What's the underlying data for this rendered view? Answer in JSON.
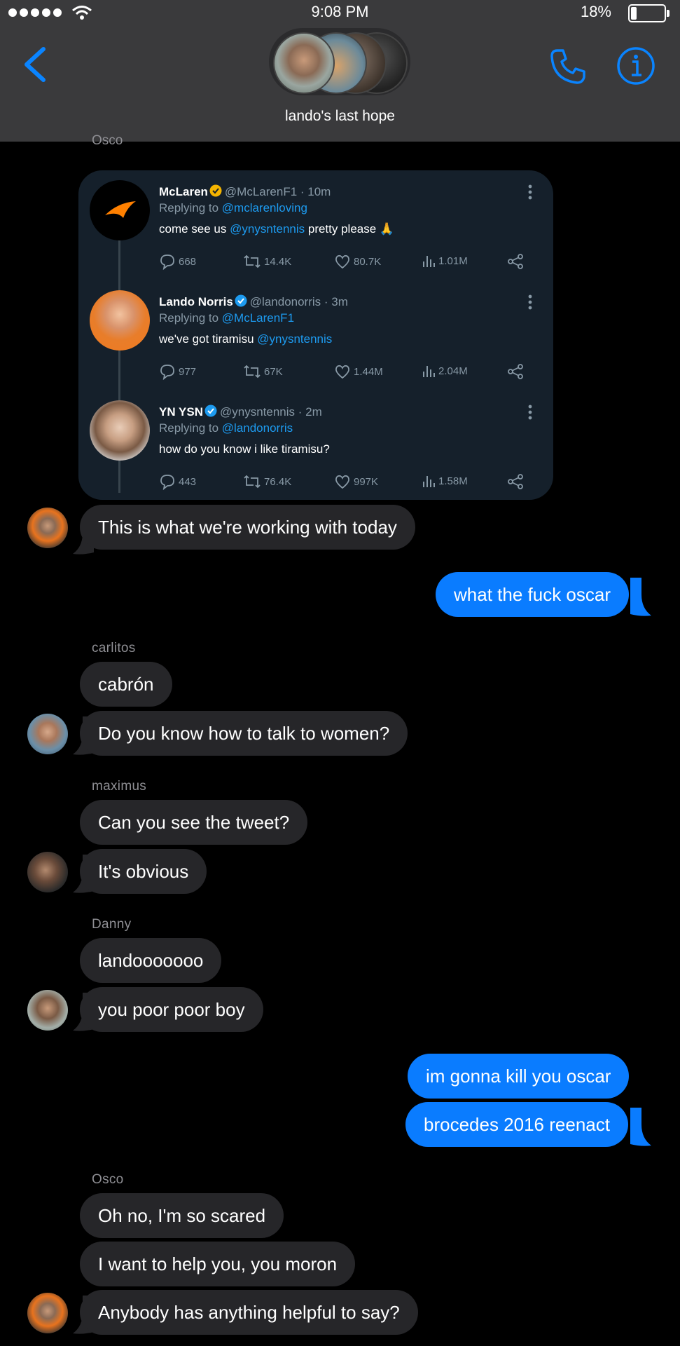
{
  "status_bar": {
    "time": "9:08 PM",
    "battery": "18%",
    "battery_level": 0.18
  },
  "header": {
    "title": "lando's last hope"
  },
  "top_sender": "Osco",
  "tweets": [
    {
      "name": "McLaren",
      "handle": "@McLarenF1 · 10m",
      "reply_prefix": "Replying to ",
      "reply_to": "@mclarenloving",
      "text_pre": "come see us ",
      "text_mention": "@ynysntennis",
      "text_post": " pretty please 🙏",
      "replies": "668",
      "retweets": "14.4K",
      "likes": "80.7K",
      "views": "1.01M",
      "badge_color": "#f4b400"
    },
    {
      "name": "Lando Norris",
      "handle": "@landonorris · 3m",
      "reply_prefix": "Replying to ",
      "reply_to": "@McLarenF1",
      "text_pre": "we've got tiramisu ",
      "text_mention": "@ynysntennis",
      "text_post": "",
      "replies": "977",
      "retweets": "67K",
      "likes": "1.44M",
      "views": "2.04M",
      "badge_color": "#1d9bf0"
    },
    {
      "name": "YN YSN",
      "handle": "@ynysntennis · 2m",
      "reply_prefix": "Replying to ",
      "reply_to": "@landonorris",
      "text_pre": "how do you know i like tiramisu?",
      "text_mention": "",
      "text_post": "",
      "replies": "443",
      "retweets": "76.4K",
      "likes": "997K",
      "views": "1.58M",
      "badge_color": "#1d9bf0"
    }
  ],
  "messages": {
    "m1": "This is what we're working with today",
    "m2": "what the fuck oscar",
    "carlitos": "carlitos",
    "m3": "cabrón",
    "m4": "Do you know how to talk to women?",
    "maximus": "maximus",
    "m5": "Can you see the tweet?",
    "m6": "It's obvious",
    "danny": "Danny",
    "m7": "landooooooo",
    "m8": "you poor poor boy",
    "m9": "im gonna kill you oscar",
    "m10": "brocedes 2016 reenact",
    "osco": "Osco",
    "m11": "Oh no, I'm so scared",
    "m12": "I want to help you, you moron",
    "m13": "Anybody has anything helpful to say?"
  },
  "colors": {
    "sent": "#0a7cff",
    "received": "#262629",
    "accent": "#0a84ff",
    "header": "#3a3a3c"
  }
}
